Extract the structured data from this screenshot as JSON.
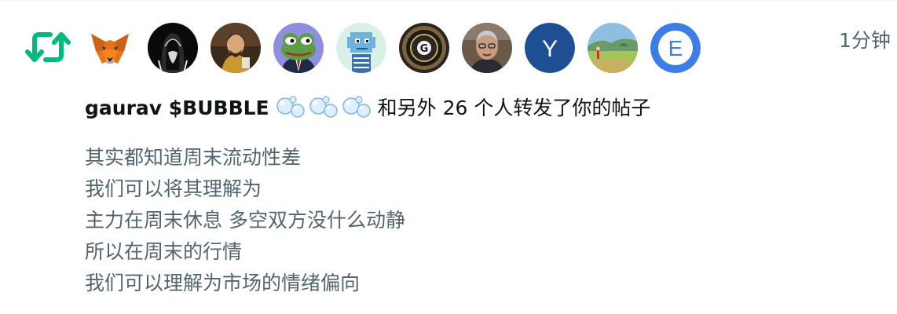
{
  "notification": {
    "type": "retweet",
    "timestamp": "1分钟",
    "actor_name": "gaurav $BUBBLE",
    "actor_emoji": "🫧🫧🫧",
    "action_text": "和另外 26 个人转发了你的帖子",
    "avatars": [
      {
        "name": "metamask-fox"
      },
      {
        "name": "hooded-figure"
      },
      {
        "name": "illustrated-man"
      },
      {
        "name": "pepe-frog"
      },
      {
        "name": "pixel-character"
      },
      {
        "name": "g-coin"
      },
      {
        "name": "older-man-photo"
      },
      {
        "name": "letter-y",
        "letter": "Y"
      },
      {
        "name": "landscape-painting"
      },
      {
        "name": "letter-e",
        "letter": "E"
      }
    ],
    "post_lines": [
      "其实都知道周末流动性差",
      "我们可以将其理解为",
      "主力在周末休息 多空双方没什么动静",
      "所以在周末的行情",
      "我们可以理解为市场的情绪偏向"
    ]
  },
  "colors": {
    "retweet_green": "#00ba7c",
    "secondary_text": "#536471",
    "primary_text": "#0f1419",
    "y_avatar_blue": "#1f4f93",
    "e_avatar_blue": "#3c7ee6"
  }
}
